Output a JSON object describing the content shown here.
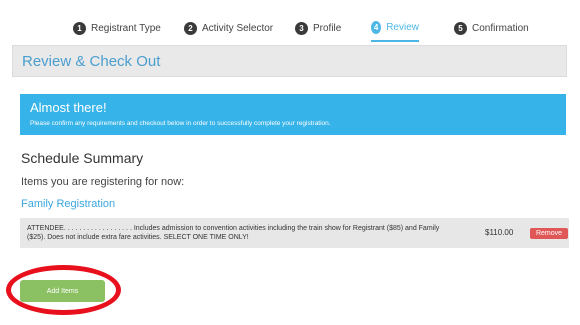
{
  "steps": [
    {
      "num": "1",
      "label": "Registrant Type"
    },
    {
      "num": "2",
      "label": "Activity Selector"
    },
    {
      "num": "3",
      "label": "Profile"
    },
    {
      "num": "4",
      "label": "Review"
    },
    {
      "num": "5",
      "label": "Confirmation"
    }
  ],
  "header": {
    "title": "Review & Check Out"
  },
  "alert": {
    "title": "Almost there!",
    "text": "Please confirm any requirements and checkout below in order to successfully complete your registration."
  },
  "summary": {
    "title": "Schedule Summary",
    "items_label": "Items you are registering for now:",
    "group_link": "Family Registration",
    "items": [
      {
        "description": "ATTENDEE. . . . . . . . . . . . . . . . . . Includes admission to convention activities including the train show for Registrant ($85) and Family ($25). Does not include extra fare activities. SELECT ONE TIME ONLY!",
        "price": "$110.00",
        "remove_label": "Remove"
      }
    ]
  },
  "actions": {
    "add_items_label": "Add Items"
  },
  "colors": {
    "accent": "#36b3e8",
    "remove": "#e05757",
    "add": "#8cc163",
    "highlight_ring": "#e8101c"
  }
}
